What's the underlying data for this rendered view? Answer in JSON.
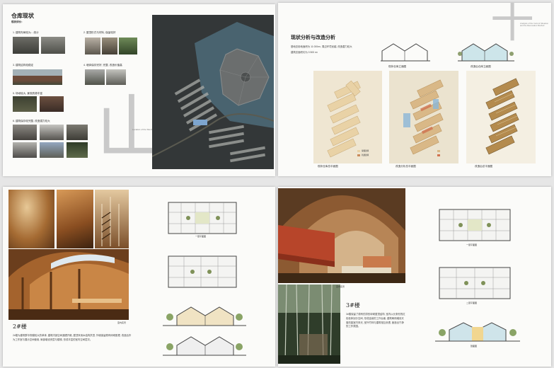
{
  "page1": {
    "title": "仓库现状",
    "subtitle": "现状评价:",
    "captions": [
      "1. 建筑布局较为... 统计",
      "2. 屋顶形式与材料, 保留较好",
      "3. 建筑结构较稳定",
      "4. 墙体保存完好, 完整, 改造价值高",
      "5. 场地较大, 景观资源丰富",
      "6. 建筑保存较完整, 改造潜力较大"
    ],
    "big_char": "山",
    "map_caption": "Location of the Site Renovation Building",
    "colors": {
      "accent": "#c9c9c9",
      "map_dark": "#2c3036",
      "water": "#4e6b79"
    }
  },
  "page2": {
    "title": "现状分析与改造分析",
    "para_lines": [
      "基地总用地面积为 11 000m², 周边环境优越, 改造潜力较大",
      "建筑总面积约为 3 500 m²"
    ],
    "section_labels": [
      "现状仓库立面图",
      "改造后仓库立面图"
    ],
    "plan_labels": [
      "现状仓库总平面图",
      "改造分析总平面图",
      "改造后总平面图"
    ],
    "legend": [
      "保留建筑",
      "新建建筑"
    ],
    "big_char": "十",
    "corner_note": "Analysis of the Current Situation and the Renovation Method"
  },
  "page3": {
    "heading": "2#楼",
    "paragraph": "2#楼为建筑群中规模较大的单体, 建筑内部空间通透开敞, 屋顶采用木结构拱顶, 外墙保留原有砖砌肌理, 改造后作为工作室与展示空间使用, 局部增设夹层与楼梯, 形成丰富的室内空间层次。",
    "photo_caption": "室内实景",
    "plan_caption": "一层平面图"
  },
  "page4": {
    "heading": "3#楼",
    "paragraph": "3#楼保留了原有的拱形砖砌屋顶结构, 室内以长条形的红色柜体划分空间, 形成连续的工作台面, 建筑两侧增设天窗改善室内采光, 室外竹林与建筑相互渗透, 营造出宁静的工作氛围。",
    "photo_caption": "室内实景",
    "plan_captions": [
      "一层平面图",
      "二层平面图",
      "剖面图"
    ]
  }
}
